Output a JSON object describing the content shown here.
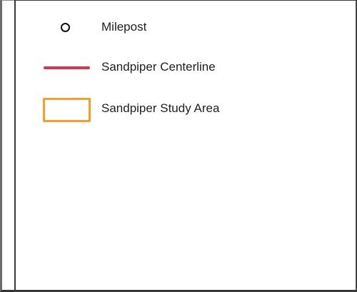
{
  "legend": {
    "items": [
      {
        "label": "Milepost",
        "symbol": "circle-outline-icon",
        "color": "#111111"
      },
      {
        "label": "Sandpiper Centerline",
        "symbol": "line-icon",
        "color": "#d9344e"
      },
      {
        "label": "Sandpiper Study Area",
        "symbol": "rectangle-outline-icon",
        "color": "#f0a02b"
      }
    ]
  }
}
